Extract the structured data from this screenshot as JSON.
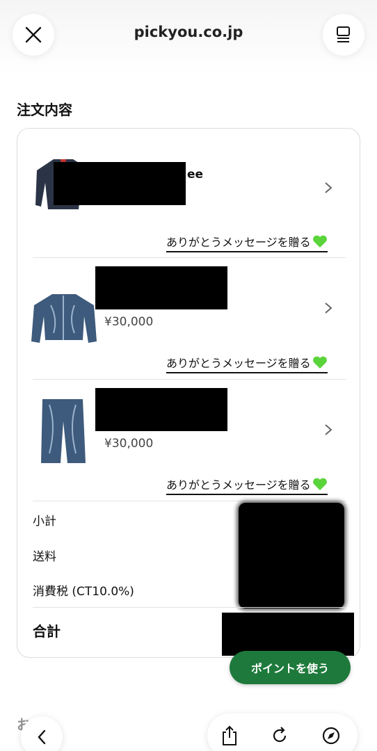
{
  "browser": {
    "domain": "pickyou.co.jp"
  },
  "icons": {
    "close": "close-icon",
    "menu": "reader-menu-icon",
    "chevron": "chevron-right-icon",
    "heart": "green-heart-icon",
    "back": "chevron-left-icon",
    "share": "share-icon",
    "reload": "reload-icon",
    "compass": "compass-icon"
  },
  "order": {
    "title": "注文内容",
    "items": [
      {
        "name_visible_fragment": "ee",
        "price": "",
        "thanks_label": "ありがとうメッセージを贈る"
      },
      {
        "name_visible_fragment": "",
        "price": "¥30,000",
        "thanks_label": "ありがとうメッセージを贈る"
      },
      {
        "name_visible_fragment": "",
        "price": "¥30,000",
        "thanks_label": "ありがとうメッセージを贈る"
      }
    ],
    "summary": {
      "subtotal_label": "小計",
      "shipping_label": "送料",
      "tax_label": "消費税 (CT10.0%)",
      "total_label": "合計"
    }
  },
  "actions": {
    "use_points_label": "ポイントを使う"
  },
  "partial_section_title": "お  い",
  "colors": {
    "accent_green": "#1e7a3c",
    "heart_green": "#5ad43b"
  }
}
